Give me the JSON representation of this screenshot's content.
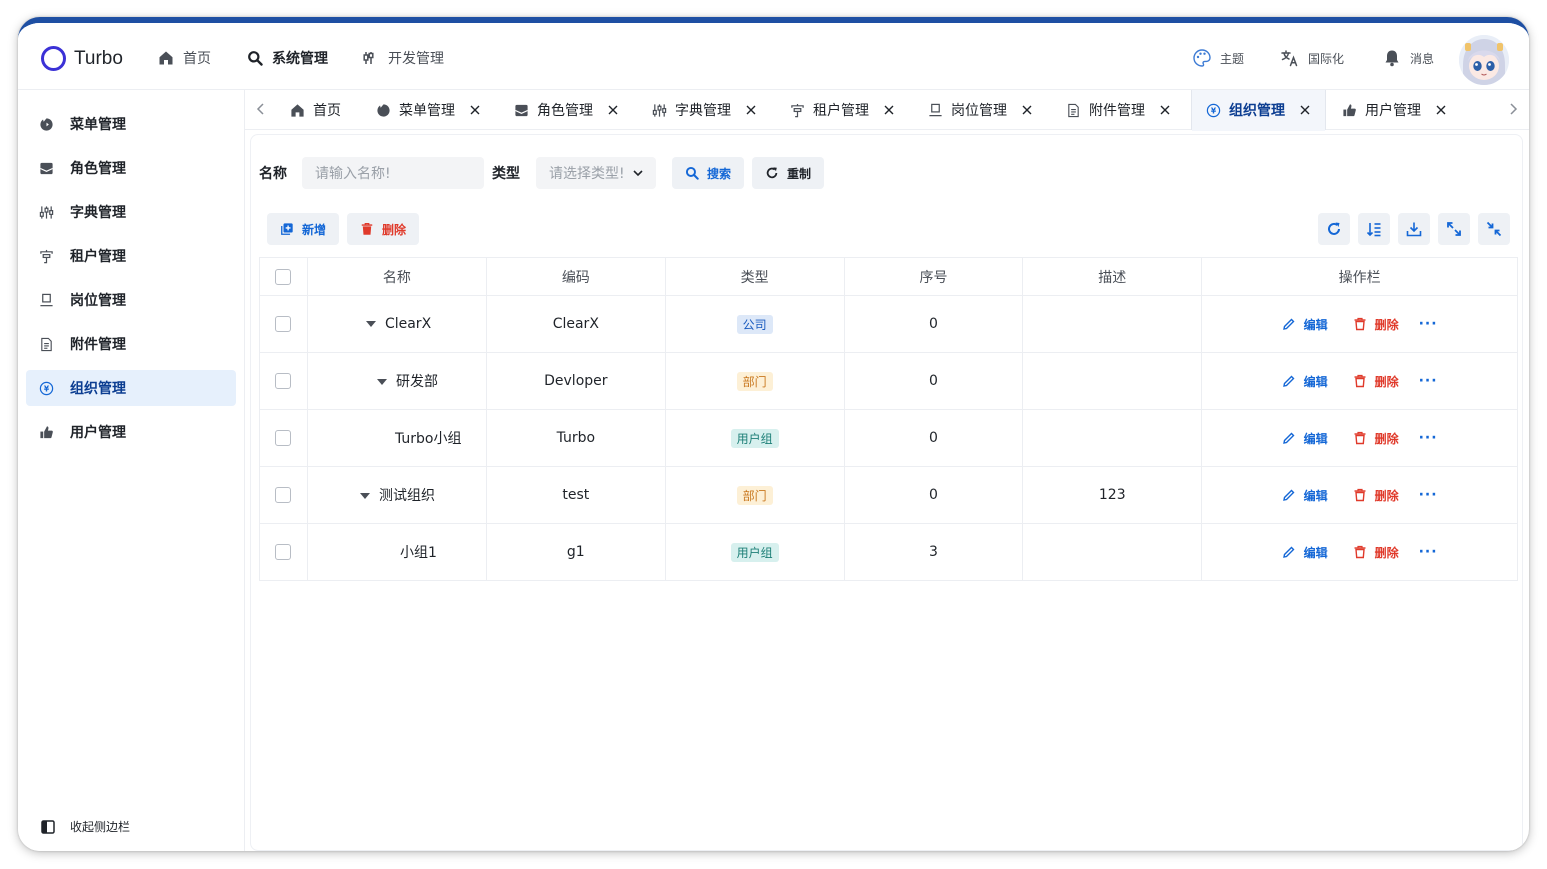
{
  "app": {
    "name": "Turbo"
  },
  "topnav": [
    {
      "label": "首页",
      "icon": "home-icon"
    },
    {
      "label": "系统管理",
      "icon": "search-icon"
    },
    {
      "label": "开发管理",
      "icon": "dev-icon"
    }
  ],
  "tools": {
    "theme": "主题",
    "i18n": "国际化",
    "messages": "消息"
  },
  "sidebar": {
    "items": [
      {
        "label": "菜单管理",
        "icon": "menu-icon"
      },
      {
        "label": "角色管理",
        "icon": "role-icon"
      },
      {
        "label": "字典管理",
        "icon": "dict-icon"
      },
      {
        "label": "租户管理",
        "icon": "tenant-icon"
      },
      {
        "label": "岗位管理",
        "icon": "post-icon"
      },
      {
        "label": "附件管理",
        "icon": "file-icon"
      },
      {
        "label": "组织管理",
        "icon": "org-icon",
        "active": true
      },
      {
        "label": "用户管理",
        "icon": "user-icon"
      }
    ],
    "collapse_label": "收起侧边栏"
  },
  "tabs": [
    {
      "label": "首页"
    },
    {
      "label": "菜单管理"
    },
    {
      "label": "角色管理"
    },
    {
      "label": "字典管理"
    },
    {
      "label": "租户管理"
    },
    {
      "label": "岗位管理"
    },
    {
      "label": "附件管理"
    },
    {
      "label": "组织管理",
      "active": true
    },
    {
      "label": "用户管理"
    }
  ],
  "search": {
    "name_label": "名称",
    "name_placeholder": "请输入名称!",
    "type_label": "类型",
    "type_placeholder": "请选择类型!",
    "search_button": "搜索",
    "reset_button": "重制"
  },
  "toolbar": {
    "add_label": "新增",
    "delete_label": "删除"
  },
  "table": {
    "columns": [
      "名称",
      "编码",
      "类型",
      "序号",
      "描述",
      "操作栏"
    ],
    "rows": [
      {
        "name": "ClearX",
        "code": "ClearX",
        "type": "公司",
        "order": "0",
        "desc": ""
      },
      {
        "name": "研发部",
        "code": "Devloper",
        "type": "部门",
        "order": "0",
        "desc": ""
      },
      {
        "name": "Turbo小组",
        "code": "Turbo",
        "type": "用户组",
        "order": "0",
        "desc": ""
      },
      {
        "name": "测试组织",
        "code": "test",
        "type": "部门",
        "order": "0",
        "desc": "123"
      },
      {
        "name": "小组1",
        "code": "g1",
        "type": "用户组",
        "order": "3",
        "desc": ""
      }
    ],
    "edit_label": "编辑",
    "delete_label": "删除",
    "more_label": "···"
  },
  "colors": {
    "accent": "#1467d6",
    "danger": "#e03a2b",
    "brand": "#3b31d6",
    "top_bar": "#1e4fa3"
  }
}
